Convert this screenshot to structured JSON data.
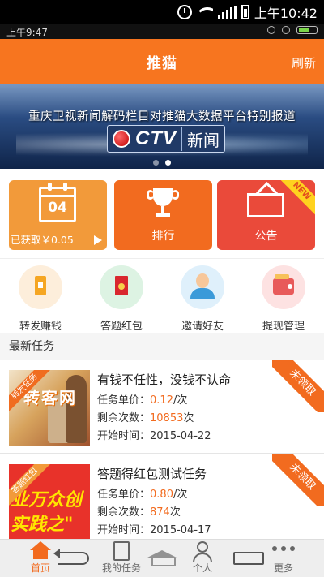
{
  "system_status": {
    "time": "上午10:42"
  },
  "inner_status": {
    "time": "上午9:47"
  },
  "header": {
    "title": "推猫",
    "refresh_label": "刷新"
  },
  "banner": {
    "headline": "重庆卫视新闻解码栏目对推猫大数据平台特别报道",
    "logo_text": "CTV",
    "logo_sub": "新闻",
    "dots": 2,
    "active_dot": 1
  },
  "tiles": [
    {
      "name": "earnings",
      "value": "04",
      "label": "已获取￥0.05",
      "color": "#f29a3a"
    },
    {
      "name": "ranking",
      "label": "排行",
      "color": "#f26b1f"
    },
    {
      "name": "announcement",
      "label": "公告",
      "badge": "NEW",
      "color": "#ea4a3a"
    }
  ],
  "icon_menu": [
    {
      "label": "转发赚钱",
      "icon": "phone-icon"
    },
    {
      "label": "答题红包",
      "icon": "red-envelope-icon"
    },
    {
      "label": "邀请好友",
      "icon": "person-icon"
    },
    {
      "label": "提现管理",
      "icon": "wallet-icon"
    }
  ],
  "section": {
    "title": "最新任务"
  },
  "tasks": [
    {
      "title": "有钱不任性，没钱不认命",
      "unit_label": "任务单价：",
      "unit_price": "0.12",
      "unit_suffix": "/次",
      "remain_label": "剩余次数：",
      "remain": "10853",
      "remain_suffix": "次",
      "start_label": "开始时间：",
      "start": "2015-04-22",
      "status": "未领取",
      "tag": "转发任务",
      "thumb_text": "转客网"
    },
    {
      "title": "答题得红包测试任务",
      "unit_label": "任务单价：",
      "unit_price": "0.80",
      "unit_suffix": "/次",
      "remain_label": "剩余次数：",
      "remain": "874",
      "remain_suffix": "次",
      "start_label": "开始时间：",
      "start": "2015-04-17",
      "status": "未领取",
      "tag": "答题红包",
      "thumb_text_1": "业万众创",
      "thumb_text_2": "实践之\""
    }
  ],
  "tabbar": [
    {
      "label": "首页",
      "icon": "home-icon",
      "active": true
    },
    {
      "label": "我的任务",
      "icon": "task-icon",
      "active": false
    },
    {
      "label": "个人",
      "icon": "user-icon",
      "active": false
    },
    {
      "label": "更多",
      "icon": "more-icon",
      "active": false
    }
  ],
  "colors": {
    "brand": "#f26b1f",
    "header": "#f7751f"
  }
}
